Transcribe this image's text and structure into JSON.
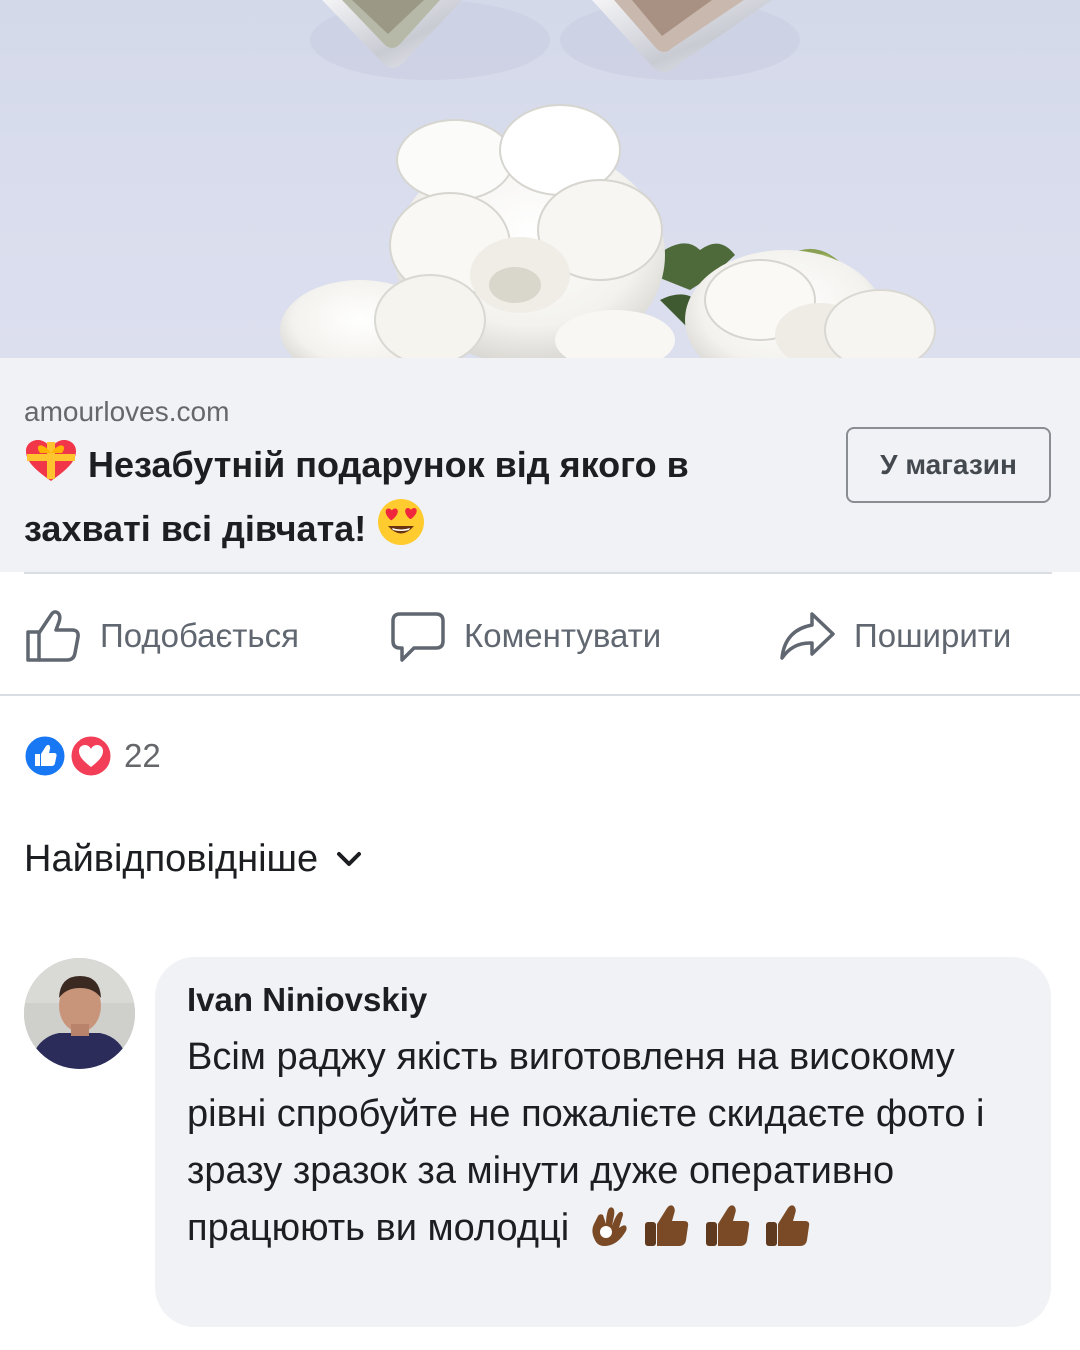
{
  "link_preview": {
    "domain": "amourloves.com",
    "title": "Незабутній подарунок від якого в захваті всі дівчата!",
    "title_leading_emoji": "gift-heart-emoji",
    "title_trailing_emoji": "heart-eyes-emoji",
    "button_label": "У магазин"
  },
  "actions": {
    "like": {
      "label": "Подобається",
      "icon": "thumbs-up-outline-icon"
    },
    "comment": {
      "label": "Коментувати",
      "icon": "comment-bubble-icon"
    },
    "share": {
      "label": "Поширити",
      "icon": "share-arrow-icon"
    }
  },
  "reactions": {
    "types": [
      "like",
      "love"
    ],
    "count": "22"
  },
  "sort": {
    "label": "Найвідповідніше",
    "icon": "chevron-down-icon"
  },
  "comment": {
    "author": "Ivan Niniovskiy",
    "text": "Всім раджу якість виготовленя на високому рівні спробуйте не пожалієте скидаєте фото і зразу зразок за мінути дуже оперативно працюють ви молодці",
    "trailing_emoji": [
      "ok-hand-emoji",
      "thumbs-up-emoji",
      "thumbs-up-emoji",
      "thumbs-up-emoji"
    ]
  },
  "colors": {
    "link_card_bg": "#f0f2f5",
    "action_text": "#606770",
    "like_blue": "#1877f2",
    "love_red": "#f33e58",
    "emoji_skin_dark": "#7a4a26"
  }
}
